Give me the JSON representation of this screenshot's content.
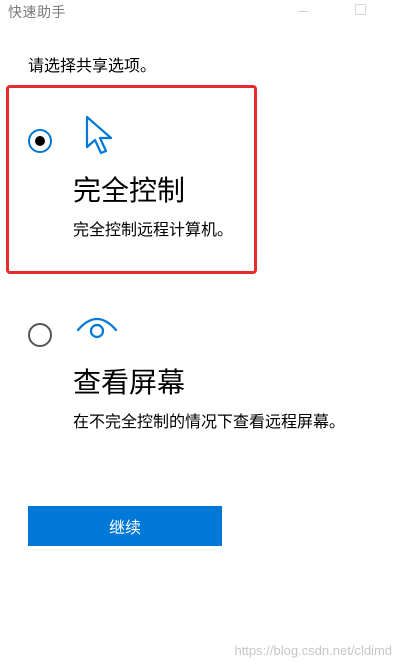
{
  "window": {
    "title": "快速助手"
  },
  "prompt": "请选择共享选项。",
  "options": [
    {
      "title": "完全控制",
      "description": "完全控制远程计算机。",
      "selected": true,
      "icon": "cursor-icon"
    },
    {
      "title": "查看屏幕",
      "description": "在不完全控制的情况下查看远程屏幕。",
      "selected": false,
      "icon": "eye-icon"
    }
  ],
  "continue_label": "继续",
  "watermark": "https://blog.csdn.net/cldimd",
  "colors": {
    "accent": "#0078d7",
    "highlight_border": "#e52b2b"
  }
}
